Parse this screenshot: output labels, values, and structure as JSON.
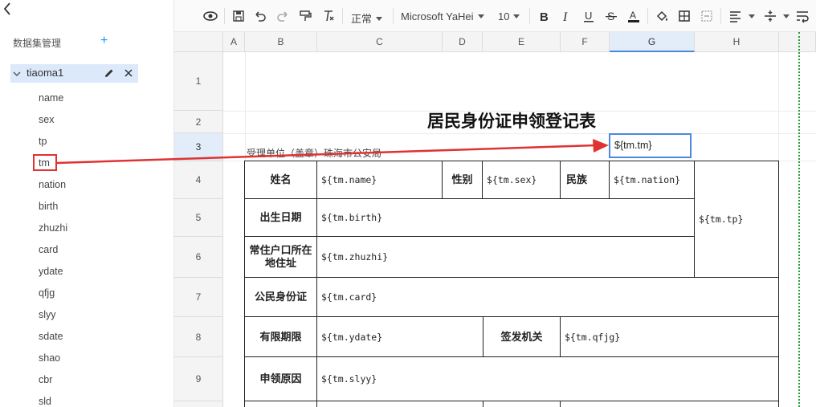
{
  "sidebar": {
    "title": "数据集管理",
    "add": "+",
    "dataset": "tiaoma1",
    "fields": [
      "name",
      "sex",
      "tp",
      "tm",
      "nation",
      "birth",
      "zhuzhi",
      "card",
      "ydate",
      "qfjg",
      "slyy",
      "sdate",
      "shao",
      "cbr",
      "sld"
    ]
  },
  "toolbar": {
    "style": "正常",
    "font": "Microsoft YaHei",
    "size": "10"
  },
  "columns": [
    "A",
    "B",
    "C",
    "D",
    "E",
    "F",
    "G",
    "H"
  ],
  "rows": [
    "1",
    "2",
    "3",
    "4",
    "5",
    "6",
    "7",
    "8",
    "9"
  ],
  "sheet": {
    "title": "居民身份证申领登记表",
    "unit": "受理单位（盖章）珠海市公安局",
    "g3": "${tm.tm}",
    "l_name": "姓名",
    "v_name": "${tm.name}",
    "l_sex": "性别",
    "v_sex": "${tm.sex}",
    "l_nation": "民族",
    "v_nation": "${tm.nation}",
    "v_tp": "${tm.tp}",
    "l_birth": "出生日期",
    "v_birth": "${tm.birth}",
    "l_addr": "常住户口所在地住址",
    "v_addr": "${tm.zhuzhi}",
    "l_card": "公民身份证",
    "v_card": "${tm.card}",
    "l_ydate": "有限期限",
    "v_ydate": "${tm.ydate}",
    "l_qfjg": "签发机关",
    "v_qfjg": "${tm.qfjg}",
    "l_slyy": "申领原因",
    "v_slyy": "${tm.slyy}"
  },
  "colors": {
    "accent": "#1890ff",
    "highlight": "#e03232",
    "selection": "#4a89dc",
    "pagebreak": "#22a03a"
  }
}
